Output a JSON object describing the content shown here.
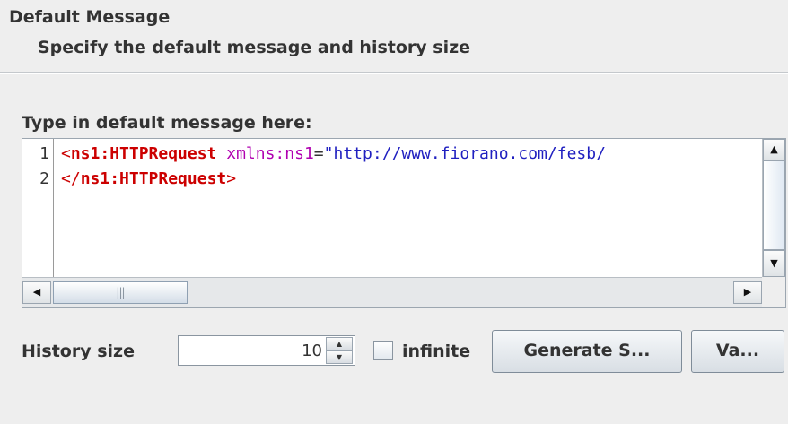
{
  "header": {
    "title": "Default Message",
    "subtitle": "Specify the default message and history size"
  },
  "editor": {
    "label": "Type in default message here:",
    "line_numbers": [
      "1",
      "2"
    ],
    "lines": [
      {
        "open_bracket": "<",
        "tag": "ns1:HTTPRequest",
        "attr_name": "xmlns:ns1",
        "equals": "=",
        "attr_value": "\"http://www.fiorano.com/fesb/"
      },
      {
        "open_bracket": "</",
        "tag": "ns1:HTTPRequest",
        "close_bracket": ">"
      }
    ],
    "hscroll_grip": "|||"
  },
  "history": {
    "label": "History size",
    "value": "10",
    "infinite_label": "infinite",
    "infinite_checked": false
  },
  "buttons": {
    "generate_label": "Generate S...",
    "validate_label": "Va..."
  },
  "colors": {
    "xml_tag": "#cc0000",
    "xml_attribute": "#b000b0",
    "xml_string": "#2020c0",
    "background": "#eeeeee"
  },
  "icons": {
    "scroll_up": "arrow-up-icon",
    "scroll_down": "arrow-down-icon",
    "scroll_left": "arrow-left-icon",
    "scroll_right": "arrow-right-icon"
  }
}
